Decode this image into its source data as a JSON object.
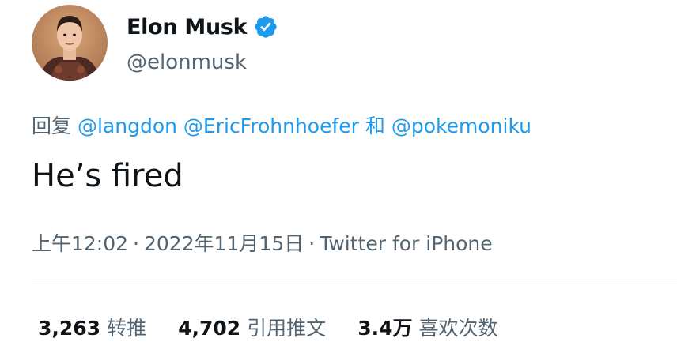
{
  "colors": {
    "accent": "#1d9bf0",
    "secondary_text": "#536471",
    "primary_text": "#0f1419",
    "divider": "#e7eaec"
  },
  "user": {
    "display_name": "Elon Musk",
    "handle": "@elonmusk",
    "verified_icon": "verified-badge-icon",
    "avatar_icon": "profile-photo"
  },
  "reply": {
    "prefix": "回复",
    "mentions": [
      "@langdon",
      "@EricFrohnhoefer",
      "@pokemoniku"
    ],
    "conjunction": "和"
  },
  "tweet": {
    "text": "He’s fired"
  },
  "meta": {
    "time": "上午12:02",
    "separator": "·",
    "date": "2022年11月15日",
    "source": "Twitter for iPhone"
  },
  "stats": [
    {
      "value": "3,263",
      "label": "转推"
    },
    {
      "value": "4,702",
      "label": "引用推文"
    },
    {
      "value": "3.4万",
      "label": "喜欢次数"
    }
  ]
}
